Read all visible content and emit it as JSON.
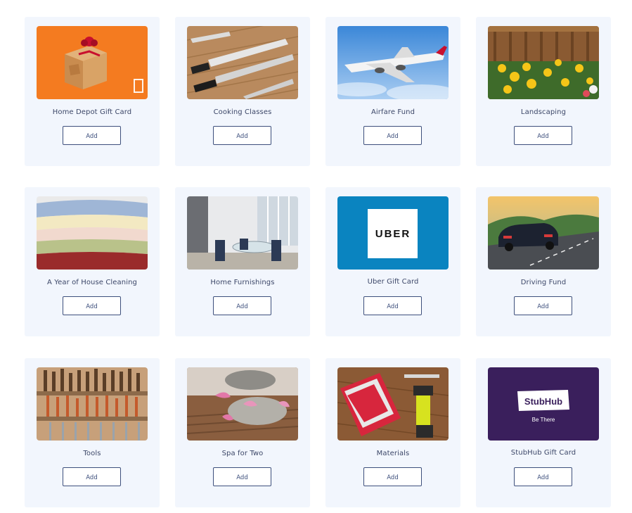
{
  "registry": {
    "items": [
      {
        "title": "Home Depot Gift Card",
        "button": "Add",
        "image": "home-depot-gift-box-image"
      },
      {
        "title": "Cooking Classes",
        "button": "Add",
        "image": "kitchen-knives-image"
      },
      {
        "title": "Airfare Fund",
        "button": "Add",
        "image": "airplane-sky-image"
      },
      {
        "title": "Landscaping",
        "button": "Add",
        "image": "flowers-fence-image"
      },
      {
        "title": "A Year of House Cleaning",
        "button": "Add",
        "image": "stacked-towels-image"
      },
      {
        "title": "Home Furnishings",
        "button": "Add",
        "image": "dining-room-image"
      },
      {
        "title": "Uber Gift Card",
        "button": "Add",
        "image": "uber-logo-card-image",
        "logo_text": "UBER"
      },
      {
        "title": "Driving Fund",
        "button": "Add",
        "image": "car-on-road-image"
      },
      {
        "title": "Tools",
        "button": "Add",
        "image": "tool-rack-image"
      },
      {
        "title": "Spa for Two",
        "button": "Add",
        "image": "spa-stones-image"
      },
      {
        "title": "Materials",
        "button": "Add",
        "image": "drill-and-box-image"
      },
      {
        "title": "StubHub Gift Card",
        "button": "Add",
        "image": "stubhub-card-image",
        "logo_text": "StubHub",
        "tagline": "Be There"
      }
    ]
  },
  "colors": {
    "card_bg": "#f2f6fd",
    "text": "#3c4768",
    "button_border": "#3d4f7c",
    "home_depot_orange": "#f96302",
    "uber_blue": "#0a84c0",
    "stubhub_purple": "#3a1f5c"
  }
}
